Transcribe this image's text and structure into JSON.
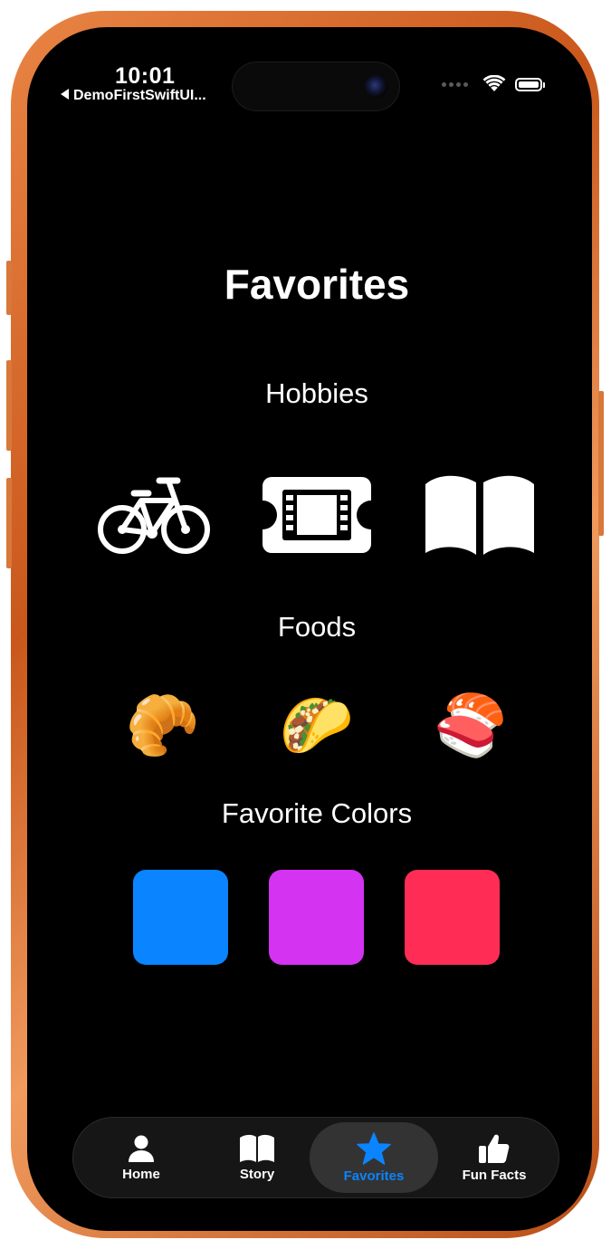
{
  "status_bar": {
    "time": "10:01",
    "back_label": "DemoFirstSwiftUI...",
    "wifi_icon": "wifi-icon",
    "battery_icon": "battery-icon"
  },
  "page": {
    "title": "Favorites"
  },
  "hobbies": {
    "label": "Hobbies",
    "items": [
      {
        "icon": "bicycle-icon"
      },
      {
        "icon": "film-ticket-icon"
      },
      {
        "icon": "open-book-icon"
      }
    ]
  },
  "foods": {
    "label": "Foods",
    "items": [
      {
        "emoji": "🥐",
        "name": "croissant"
      },
      {
        "emoji": "🌮",
        "name": "taco"
      },
      {
        "emoji": "🍣",
        "name": "sushi"
      }
    ]
  },
  "colors": {
    "label": "Favorite Colors",
    "swatches": [
      "#0a84ff",
      "#d433f2",
      "#ff2d55"
    ]
  },
  "tab_bar": {
    "accent": "#0a84ff",
    "tabs": [
      {
        "label": "Home",
        "icon": "person-icon"
      },
      {
        "label": "Story",
        "icon": "book-icon"
      },
      {
        "label": "Favorites",
        "icon": "star-icon",
        "selected": true
      },
      {
        "label": "Fun Facts",
        "icon": "thumbs-up-icon"
      }
    ]
  }
}
